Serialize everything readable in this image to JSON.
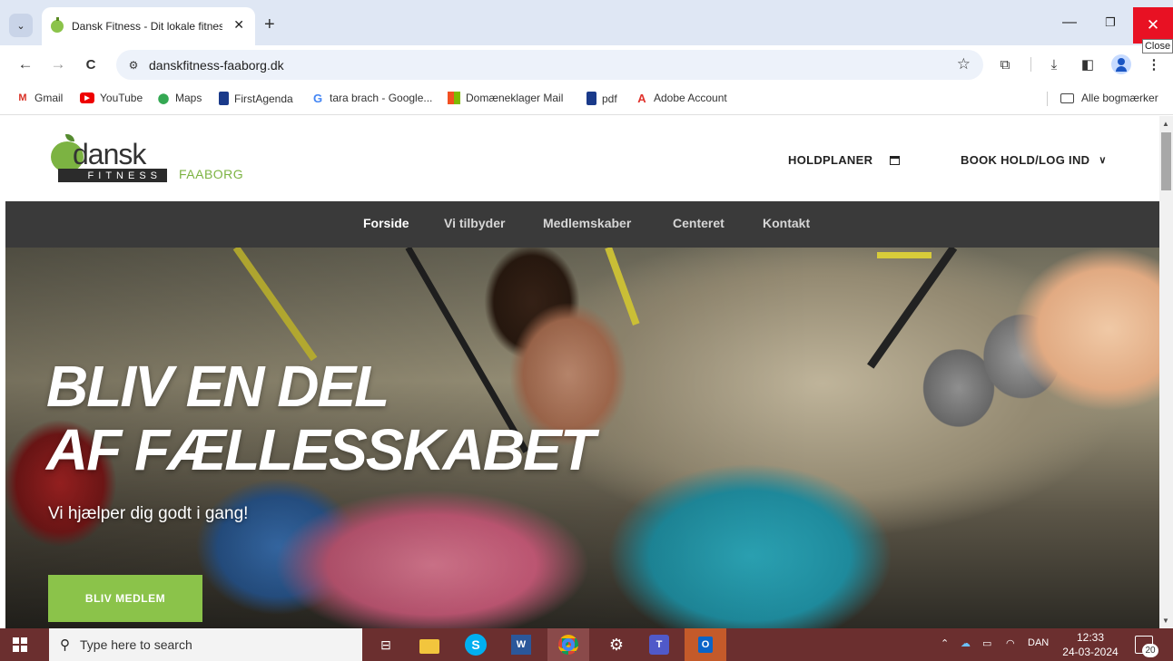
{
  "browser": {
    "tab": {
      "title": "Dansk Fitness - Dit lokale fitnes",
      "close": "✕"
    },
    "new_tab": "+",
    "window": {
      "minimize": "—",
      "restore": "❐",
      "close": "✕",
      "close_tooltip": "Close"
    },
    "toolbar": {
      "back": "←",
      "forward": "→",
      "reload": "C",
      "url": "danskfitness-faaborg.dk"
    },
    "bookmarks": [
      {
        "label": "Gmail",
        "icon": "gmail-icon"
      },
      {
        "label": "YouTube",
        "icon": "youtube-icon"
      },
      {
        "label": "Maps",
        "icon": "maps-icon"
      },
      {
        "label": "FirstAgenda",
        "icon": "bookmark-icon"
      },
      {
        "label": "tara brach - Google...",
        "icon": "google-icon"
      },
      {
        "label": "Domæneklager Mail",
        "icon": "microsoft-icon"
      },
      {
        "label": "pdf",
        "icon": "bookmark-icon"
      },
      {
        "label": "Adobe Account",
        "icon": "adobe-icon"
      }
    ],
    "all_bookmarks": "Alle bogmærker"
  },
  "site": {
    "logo": {
      "word": "dansk",
      "sub": "FITNESS",
      "town": "FAABORG"
    },
    "header_links": {
      "holdplaner": "HOLDPLANER",
      "book": "BOOK HOLD/LOG IND"
    },
    "nav": [
      "Forside",
      "Vi tilbyder",
      "Medlemskaber",
      "Centeret",
      "Kontakt"
    ],
    "hero": {
      "title_line1": "BLIV EN DEL",
      "title_line2": "AF FÆLLESSKABET",
      "subtitle": "Vi hjælper dig godt i gang!",
      "cta": "BLIV MEDLEM"
    }
  },
  "taskbar": {
    "search_placeholder": "Type here to search",
    "language": "DAN",
    "time": "12:33",
    "date": "24-03-2024",
    "notification_count": "20"
  },
  "colors": {
    "brand_green": "#8bc34a",
    "navbar": "#3a3a3a",
    "close_red": "#e81123",
    "taskbar": "#6b2f2f"
  }
}
